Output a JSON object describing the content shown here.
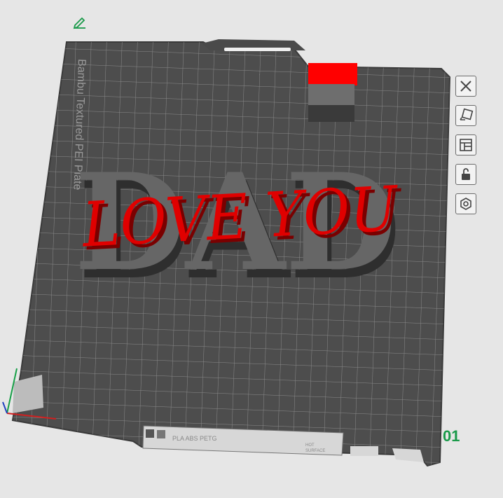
{
  "plate": {
    "name": "Bambu Textured PEI Plate",
    "number": "01",
    "strip_text": "PLA ABS PETG",
    "hot_surface_1": "HOT",
    "hot_surface_2": "SURFACE"
  },
  "model": {
    "base_text": "DAD",
    "overlay_text": "LOVE YOU",
    "base_color": "#555555",
    "overlay_color": "#e00000"
  },
  "toolbar": {
    "icons": [
      "close-icon",
      "auto-orient-icon",
      "arrange-icon",
      "lock-icon",
      "hexagon-icon"
    ]
  },
  "colors": {
    "plate": "#4d4d4d",
    "grid": "#8a8a8a",
    "accent_green": "#1a9a4a",
    "swatch_red": "#ff0000",
    "swatch_grey": "#6e6e6e",
    "swatch_dark": "#3a3a3a"
  }
}
